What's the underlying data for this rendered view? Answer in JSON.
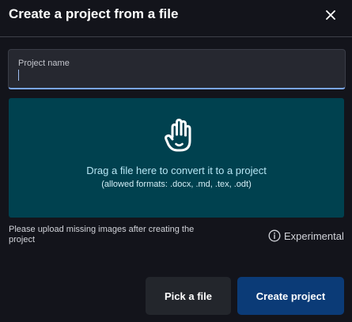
{
  "dialog": {
    "title": "Create a project from a file",
    "close_icon": "close-icon"
  },
  "project_name_field": {
    "label": "Project name",
    "value": ""
  },
  "dropzone": {
    "icon": "hand-icon",
    "message": "Drag a file here to convert it to a project",
    "formats": "(allowed formats: .docx, .md, .tex, .odt)"
  },
  "note": "Please upload missing images after creating the project",
  "experimental": {
    "icon": "info-icon",
    "label": "Experimental"
  },
  "buttons": {
    "pick_file": "Pick a file",
    "create_project": "Create project"
  },
  "colors": {
    "background": "#13141b",
    "dropzone": "#00414f",
    "primary_button": "#0b3b77",
    "secondary_button": "#23262c",
    "focus_border": "#7aa6e8"
  }
}
